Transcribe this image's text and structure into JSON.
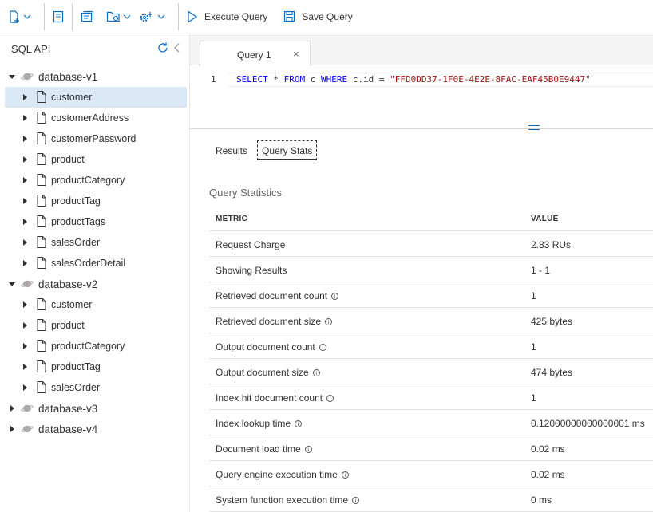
{
  "toolbar": {
    "execute_label": "Execute Query",
    "save_label": "Save Query"
  },
  "sidebar": {
    "title": "SQL API",
    "databases": [
      {
        "name": "database-v1",
        "expanded": true,
        "containers": [
          "customer",
          "customerAddress",
          "customerPassword",
          "product",
          "productCategory",
          "productTag",
          "productTags",
          "salesOrder",
          "salesOrderDetail"
        ]
      },
      {
        "name": "database-v2",
        "expanded": true,
        "containers": [
          "customer",
          "product",
          "productCategory",
          "productTag",
          "salesOrder"
        ]
      },
      {
        "name": "database-v3",
        "expanded": false,
        "containers": []
      },
      {
        "name": "database-v4",
        "expanded": false,
        "containers": []
      }
    ],
    "selected": "customer"
  },
  "editor": {
    "tab_label": "Query 1",
    "tab_close": "×",
    "line_number": "1",
    "query_tokens": [
      {
        "t": "SELECT",
        "k": "kw"
      },
      {
        "t": " * ",
        "k": ""
      },
      {
        "t": "FROM",
        "k": "kw"
      },
      {
        "t": " c ",
        "k": ""
      },
      {
        "t": "WHERE",
        "k": "kw"
      },
      {
        "t": " c.id = ",
        "k": ""
      },
      {
        "t": "\"FFD0DD37-1F0E-4E2E-8FAC-EAF45B0E9447\"",
        "k": "str"
      }
    ]
  },
  "results": {
    "tabs": {
      "results": "Results",
      "stats": "Query Stats"
    },
    "title": "Query Statistics",
    "headers": {
      "metric": "METRIC",
      "value": "VALUE"
    },
    "rows": [
      {
        "metric": "Request Charge",
        "value": "2.83 RUs",
        "info": false
      },
      {
        "metric": "Showing Results",
        "value": "1 - 1",
        "info": false
      },
      {
        "metric": "Retrieved document count",
        "value": "1",
        "info": true
      },
      {
        "metric": "Retrieved document size",
        "value": "425 bytes",
        "info": true
      },
      {
        "metric": "Output document count",
        "value": "1",
        "info": true
      },
      {
        "metric": "Output document size",
        "value": "474 bytes",
        "info": true
      },
      {
        "metric": "Index hit document count",
        "value": "1",
        "info": true
      },
      {
        "metric": "Index lookup time",
        "value": "0.12000000000000001 ms",
        "info": true
      },
      {
        "metric": "Document load time",
        "value": "0.02 ms",
        "info": true
      },
      {
        "metric": "Query engine execution time",
        "value": "0.02 ms",
        "info": true
      },
      {
        "metric": "System function execution time",
        "value": "0 ms",
        "info": true
      }
    ]
  },
  "colors": {
    "accent": "#0f6cbd",
    "selection": "#dbe9f7",
    "keyword": "#0000ff",
    "string": "#a31515"
  }
}
